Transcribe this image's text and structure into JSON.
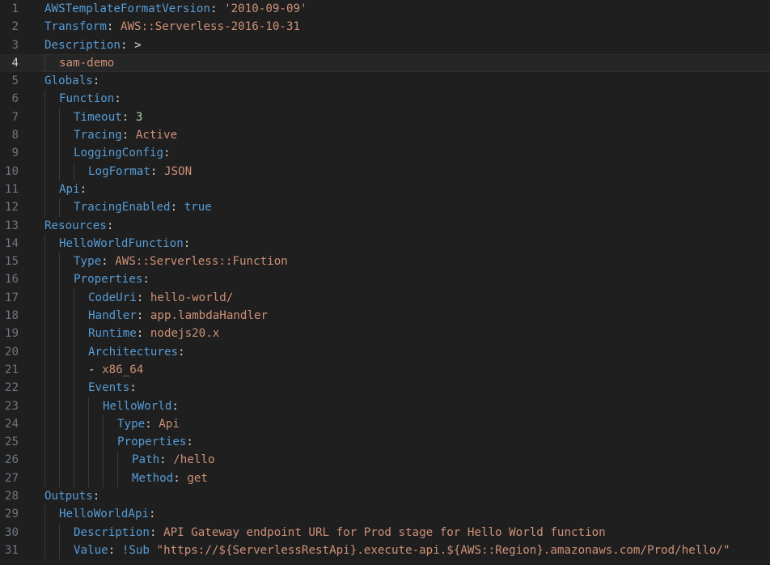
{
  "lines": [
    {
      "no": "1",
      "tokens": [
        {
          "k": "AWSTemplateFormatVersion"
        },
        {
          "p": ": "
        },
        {
          "s": "'2010-09-09'"
        }
      ]
    },
    {
      "no": "2",
      "tokens": [
        {
          "k": "Transform"
        },
        {
          "p": ": "
        },
        {
          "s": "AWS::Serverless-2016-10-31"
        }
      ]
    },
    {
      "no": "3",
      "tokens": [
        {
          "k": "Description"
        },
        {
          "p": ": "
        },
        {
          "p": ">"
        }
      ]
    },
    {
      "no": "4",
      "tokens": [
        {
          "s": "sam-demo"
        }
      ]
    },
    {
      "no": "5",
      "tokens": [
        {
          "k": "Globals"
        },
        {
          "p": ":"
        }
      ]
    },
    {
      "no": "6",
      "tokens": [
        {
          "k": "Function"
        },
        {
          "p": ":"
        }
      ]
    },
    {
      "no": "7",
      "tokens": [
        {
          "k": "Timeout"
        },
        {
          "p": ": "
        },
        {
          "n": "3"
        }
      ]
    },
    {
      "no": "8",
      "tokens": [
        {
          "k": "Tracing"
        },
        {
          "p": ": "
        },
        {
          "s": "Active"
        }
      ]
    },
    {
      "no": "9",
      "tokens": [
        {
          "k": "LoggingConfig"
        },
        {
          "p": ":"
        }
      ]
    },
    {
      "no": "10",
      "tokens": [
        {
          "k": "LogFormat"
        },
        {
          "p": ": "
        },
        {
          "s": "JSON"
        }
      ]
    },
    {
      "no": "11",
      "tokens": [
        {
          "k": "Api"
        },
        {
          "p": ":"
        }
      ]
    },
    {
      "no": "12",
      "tokens": [
        {
          "k": "TracingEnabled"
        },
        {
          "p": ": "
        },
        {
          "b": "true"
        }
      ]
    },
    {
      "no": "13",
      "tokens": [
        {
          "k": "Resources"
        },
        {
          "p": ":"
        }
      ]
    },
    {
      "no": "14",
      "tokens": [
        {
          "k": "HelloWorldFunction"
        },
        {
          "p": ":"
        }
      ]
    },
    {
      "no": "15",
      "tokens": [
        {
          "k": "Type"
        },
        {
          "p": ": "
        },
        {
          "s": "AWS::Serverless::Function"
        }
      ]
    },
    {
      "no": "16",
      "tokens": [
        {
          "k": "Properties"
        },
        {
          "p": ":"
        }
      ]
    },
    {
      "no": "17",
      "tokens": [
        {
          "k": "CodeUri"
        },
        {
          "p": ": "
        },
        {
          "s": "hello-world/"
        }
      ]
    },
    {
      "no": "18",
      "tokens": [
        {
          "k": "Handler"
        },
        {
          "p": ": "
        },
        {
          "s": "app.lambdaHandler"
        }
      ]
    },
    {
      "no": "19",
      "tokens": [
        {
          "k": "Runtime"
        },
        {
          "p": ": "
        },
        {
          "s": "nodejs20.x"
        }
      ]
    },
    {
      "no": "20",
      "tokens": [
        {
          "k": "Architectures"
        },
        {
          "p": ":"
        }
      ]
    },
    {
      "no": "21",
      "tokens": [
        {
          "p": "- "
        },
        {
          "s": "x86_64"
        }
      ]
    },
    {
      "no": "22",
      "tokens": [
        {
          "k": "Events"
        },
        {
          "p": ":"
        }
      ]
    },
    {
      "no": "23",
      "tokens": [
        {
          "k": "HelloWorld"
        },
        {
          "p": ":"
        }
      ]
    },
    {
      "no": "24",
      "tokens": [
        {
          "k": "Type"
        },
        {
          "p": ": "
        },
        {
          "s": "Api"
        }
      ]
    },
    {
      "no": "25",
      "tokens": [
        {
          "k": "Properties"
        },
        {
          "p": ":"
        }
      ]
    },
    {
      "no": "26",
      "tokens": [
        {
          "k": "Path"
        },
        {
          "p": ": "
        },
        {
          "s": "/hello"
        }
      ]
    },
    {
      "no": "27",
      "tokens": [
        {
          "k": "Method"
        },
        {
          "p": ": "
        },
        {
          "s": "get"
        }
      ]
    },
    {
      "no": "28",
      "tokens": [
        {
          "k": "Outputs"
        },
        {
          "p": ":"
        }
      ]
    },
    {
      "no": "29",
      "tokens": [
        {
          "k": "HelloWorldApi"
        },
        {
          "p": ":"
        }
      ]
    },
    {
      "no": "30",
      "tokens": [
        {
          "k": "Description"
        },
        {
          "p": ": "
        },
        {
          "s": "API Gateway endpoint URL for Prod stage for Hello World function"
        }
      ]
    },
    {
      "no": "31",
      "tokens": [
        {
          "k": "Value"
        },
        {
          "p": ": "
        },
        {
          "t": "!Sub"
        },
        {
          "p": " "
        },
        {
          "s": "\"https://${ServerlessRestApi}.execute-api.${AWS::Region}.amazonaws.com/Prod/hello/\""
        }
      ]
    }
  ],
  "active_line": "4"
}
